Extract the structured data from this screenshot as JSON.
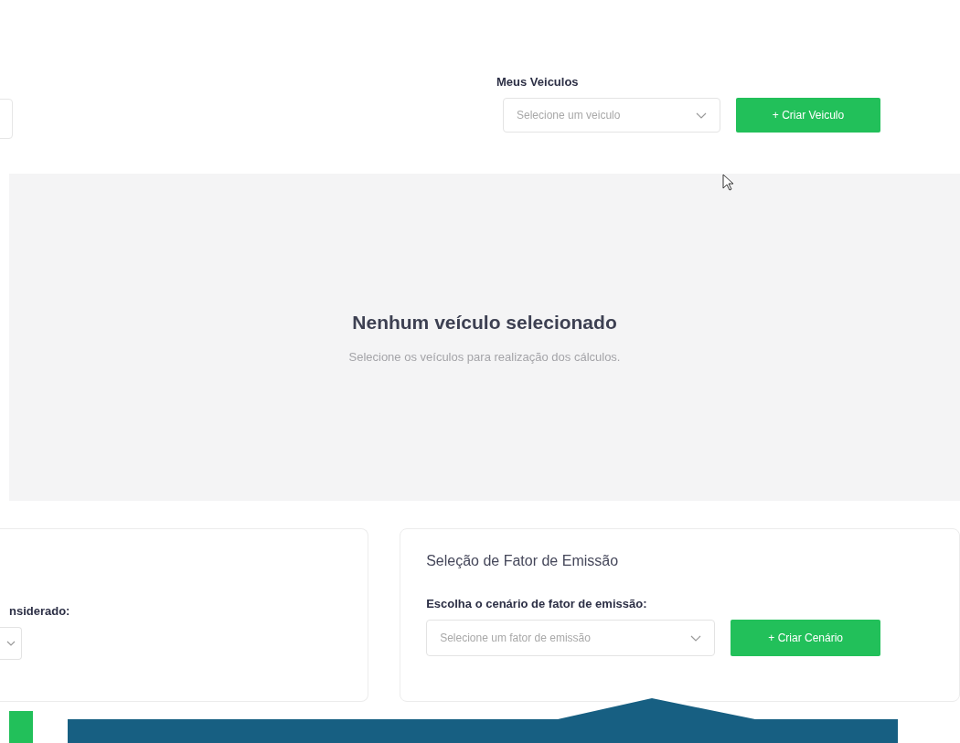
{
  "header": {
    "vehicles_label": "Meus Veiculos",
    "vehicle_select": {
      "placeholder": "Selecione um veiculo"
    },
    "create_button": "+ Criar Veiculo"
  },
  "empty_state": {
    "title": "Nenhum veículo selecionado",
    "message": "Selecione os veículos para realização dos cálculos."
  },
  "left_card": {
    "label": "nsiderado:"
  },
  "emission_card": {
    "title": "Seleção de Fator de Emissão",
    "label": "Escolha o cenário de fator de emissão:",
    "select": {
      "placeholder": "Selecione um fator de emissão"
    },
    "create_button": "+ Criar Cenário"
  }
}
